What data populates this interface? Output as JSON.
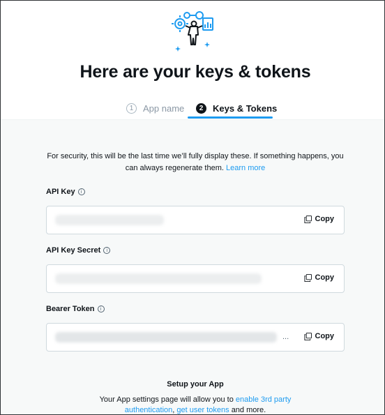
{
  "page": {
    "title": "Here are your keys & tokens",
    "accent_color": "#1d9bf0"
  },
  "steps": [
    {
      "number": "1",
      "label": "App name",
      "state": "inactive"
    },
    {
      "number": "2",
      "label": "Keys & Tokens",
      "state": "active"
    }
  ],
  "notice": {
    "text": "For security, this will be the last time we’ll fully display these. If something happens, you can always regenerate them.",
    "link": "Learn more"
  },
  "fields": [
    {
      "label": "API Key",
      "value_state": "blurred",
      "trailing": "",
      "copy_label": "Copy",
      "icon": "info-icon"
    },
    {
      "label": "API Key Secret",
      "value_state": "blurred",
      "trailing": "",
      "copy_label": "Copy",
      "icon": "info-icon"
    },
    {
      "label": "Bearer Token",
      "value_state": "blurred",
      "trailing": "...",
      "copy_label": "Copy",
      "icon": "info-icon"
    }
  ],
  "setup": {
    "title": "Setup your App",
    "text_before": "Your App settings page will allow you to",
    "link1": "enable 3rd party authentication",
    "separator": ",",
    "link2": "get user tokens",
    "text_after": "and more."
  },
  "icons": [
    "keys-illustration-icon",
    "info-icon",
    "copy-icon"
  ]
}
